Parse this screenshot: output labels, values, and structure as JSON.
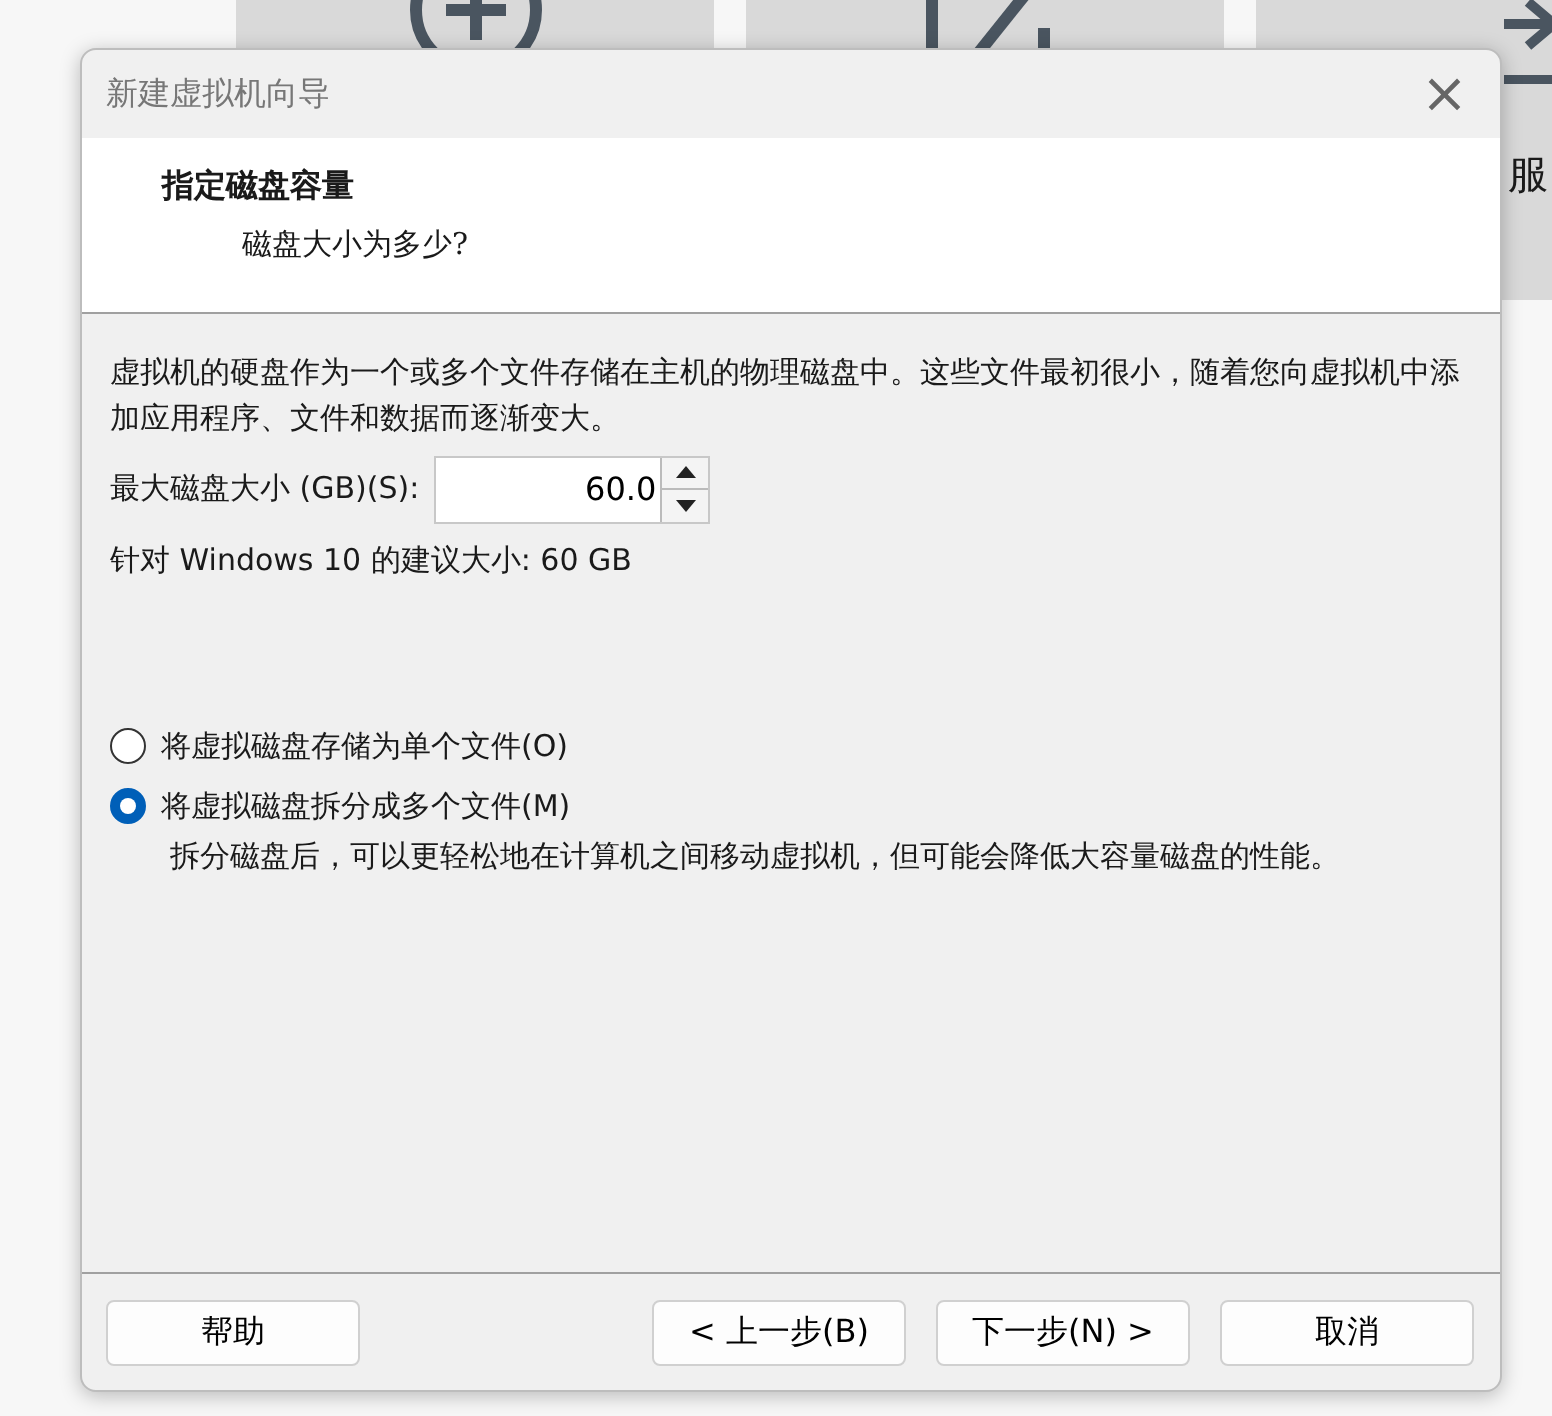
{
  "background": {
    "tiles": [
      {
        "kind": "add"
      },
      {
        "kind": "edit"
      },
      {
        "kind": "arrow",
        "label": "服"
      }
    ]
  },
  "window": {
    "title": "新建虚拟机向导",
    "close": "×"
  },
  "header": {
    "title": "指定磁盘容量",
    "subtitle": "磁盘大小为多少?"
  },
  "description": "虚拟机的硬盘作为一个或多个文件存储在主机的物理磁盘中。这些文件最初很小，随着您向虚拟机中添加应用程序、文件和数据而逐渐变大。",
  "disk_size": {
    "label": "最大磁盘大小 (GB)(S):",
    "value": "60.0"
  },
  "recommendation": "针对 Windows 10 的建议大小: 60 GB",
  "options": [
    {
      "label": "将虚拟磁盘存储为单个文件(O)",
      "selected": false
    },
    {
      "label": "将虚拟磁盘拆分成多个文件(M)",
      "selected": true,
      "note": "拆分磁盘后，可以更轻松地在计算机之间移动虚拟机，但可能会降低大容量磁盘的性能。"
    }
  ],
  "buttons": [
    {
      "label": "帮助",
      "kind": "help"
    },
    {
      "label": "< 上一步(B)",
      "kind": "nav"
    },
    {
      "label": "下一步(N) >",
      "kind": "nav"
    },
    {
      "label": "取消",
      "kind": "nav"
    }
  ]
}
